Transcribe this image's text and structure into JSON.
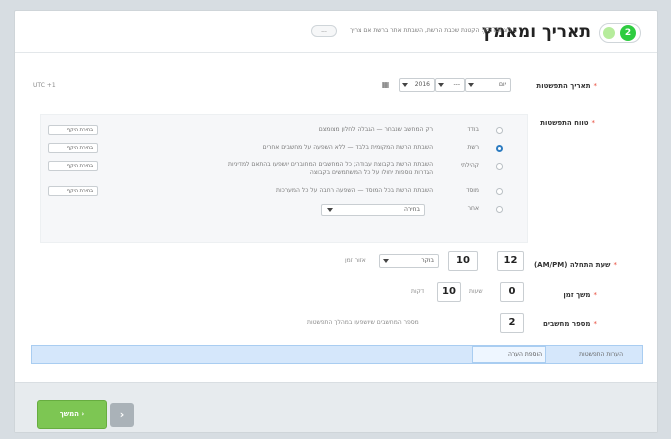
{
  "header": {
    "step_number": "2",
    "title": "תאריך ומאמץ",
    "subtitle": "JF3TSI: הקטנת שכבת הרשת, השבתת אתר ברשת אם צריך",
    "subtitle_prefix": "3 סוג",
    "toggle_label": "...",
    "accent_color": "#2ecc40"
  },
  "date_field": {
    "label": "תאריך התפשטות",
    "year_select": "2016",
    "month_select": "---",
    "day_select": "יום",
    "calendar_icon": "calendar-icon",
    "timezone_link": "UTC +1"
  },
  "scope_field": {
    "label": "טווח התפשטות",
    "options": [
      {
        "label": "בודד",
        "desc": "רק המחשב שנבחר — הגבלה לחלון מצומצם",
        "selected": false,
        "extra": "בחירת היקף"
      },
      {
        "label": "רשת",
        "desc": "השבתת הרשת המקומית בלבד — ללא השפעה על מחשבים אחרים",
        "selected": true,
        "extra": "בחירת היקף"
      },
      {
        "label": "קהילתי",
        "desc": "השבתת הרשת בקבוצת עבודה; כל המחשבים המחוברים יושפעו בהתאם למדיניות",
        "desc2": "הגדרות נוספות יחולו על כל המשתמשים בקבוצה",
        "selected": false,
        "extra": "בחירת היקף"
      },
      {
        "label": "מוסד",
        "desc": "השבתת הרשת בכל המוסד — השפעה רחבה על כל המערכות",
        "selected": false,
        "extra": "בחירת היקף"
      },
      {
        "label": "אחר",
        "desc": "",
        "selected": false,
        "extra": ""
      }
    ],
    "other_select_placeholder": "בחירה"
  },
  "time_field": {
    "label": "שעת התחלה (AM/PM)",
    "hours": "12",
    "minutes": "10",
    "ampm_select": "בוקר",
    "timezone_link": "אזור זמן"
  },
  "duration_field": {
    "label": "משך זמן",
    "hours": "0",
    "hours_unit": "שעות",
    "minutes": "10",
    "minutes_unit": "דקות"
  },
  "computers_field": {
    "label": "מספר מחשבים",
    "value": "2",
    "hint": "מספר המחשבים שיושפעו במהלך התפשטות"
  },
  "cause_field": {
    "label": "הערות התפשטות",
    "value": "הוספת הערה"
  },
  "footer": {
    "next_label": "המשך ›",
    "prev_label": "‹"
  }
}
